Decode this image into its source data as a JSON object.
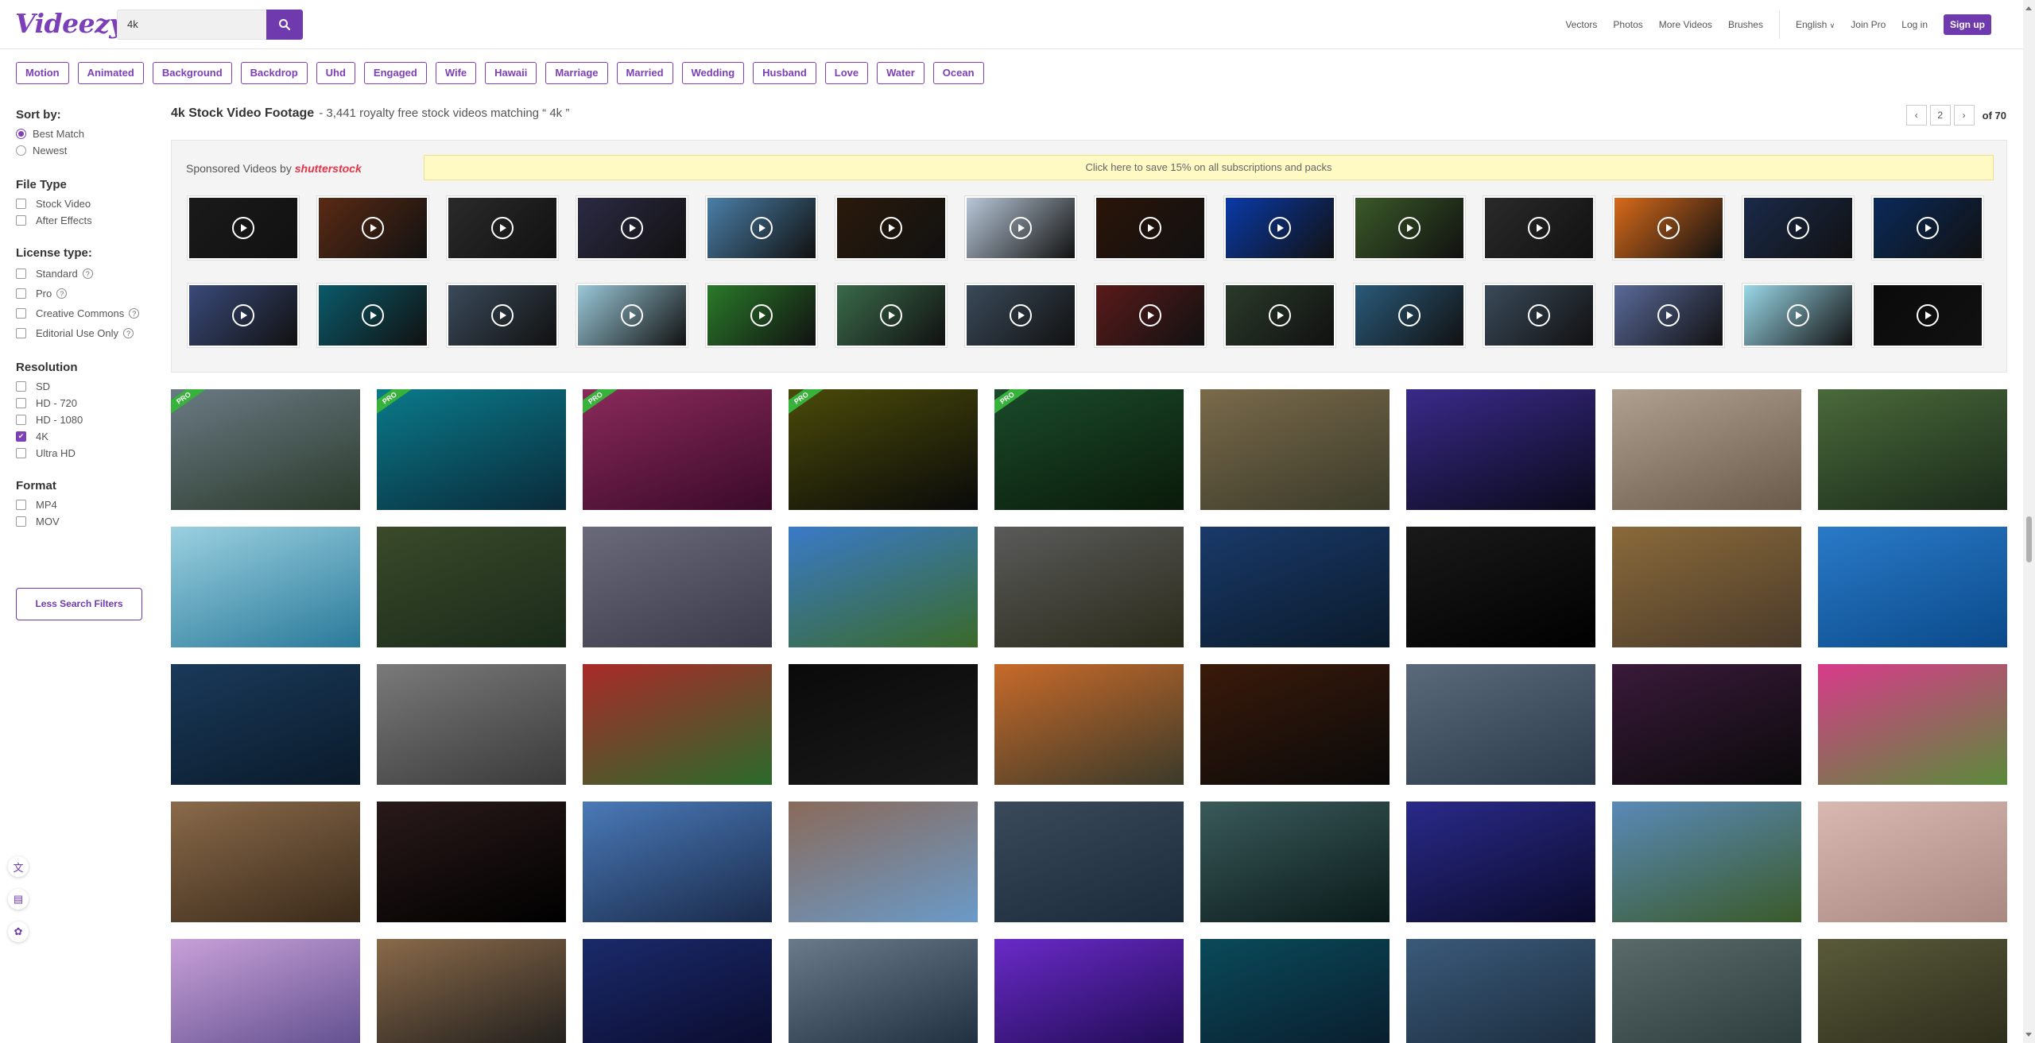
{
  "header": {
    "logo": "Videezy",
    "search_value": "4k",
    "nav": [
      "Vectors",
      "Photos",
      "More Videos",
      "Brushes"
    ],
    "language": "English",
    "join_pro": "Join Pro",
    "log_in": "Log in",
    "sign_up": "Sign up"
  },
  "tags": [
    "Motion",
    "Animated",
    "Background",
    "Backdrop",
    "Uhd",
    "Engaged",
    "Wife",
    "Hawaii",
    "Marriage",
    "Married",
    "Wedding",
    "Husband",
    "Love",
    "Water",
    "Ocean"
  ],
  "sidebar": {
    "sort_title": "Sort by:",
    "sort_options": [
      "Best Match",
      "Newest"
    ],
    "file_type_title": "File Type",
    "file_types": [
      "Stock Video",
      "After Effects"
    ],
    "license_title": "License type:",
    "licenses": [
      "Standard",
      "Pro",
      "Creative Commons",
      "Editorial Use Only"
    ],
    "resolution_title": "Resolution",
    "resolutions": [
      "SD",
      "HD - 720",
      "HD - 1080",
      "4K",
      "Ultra HD"
    ],
    "format_title": "Format",
    "formats": [
      "MP4",
      "MOV"
    ],
    "less_filters": "Less Search Filters"
  },
  "results": {
    "title": "4k Stock Video Footage",
    "subtitle": "- 3,441 royalty free stock videos matching “ 4k ”",
    "page": "2",
    "of_pages": "of 70"
  },
  "sponsored": {
    "label": "Sponsored Videos by",
    "brand": "shutterstock",
    "promo": "Click here to save 15% on all subscriptions and packs",
    "thumbs": [
      "#1a1a1a",
      "#5a2a14",
      "#2a2a2a",
      "#2c2a44",
      "#4a7fa8",
      "#2a1a0a",
      "#b8c8d8",
      "#2a1408",
      "#0a3aa8",
      "#3a5a28",
      "#2a2a2a",
      "#d86a1a",
      "#1a2a4a",
      "#0a2a5a",
      "#3a4a7a",
      "#0a5a6a",
      "#3a4a5a",
      "#9ac8d8",
      "#2a7a2a",
      "#3a6a4a",
      "#3a4a5a",
      "#5a1a1a",
      "#2a3a2a",
      "#2a5a7a",
      "#3a4a5a",
      "#5a6a9a",
      "#9ad8e8",
      "#0a0a0a"
    ]
  },
  "grid": {
    "thumbs": [
      {
        "c1": "#6a7a84",
        "c2": "#2a3a2a",
        "pro": true
      },
      {
        "c1": "#0a7a8a",
        "c2": "#0a2a3a",
        "pro": true
      },
      {
        "c1": "#8a2a5a",
        "c2": "#3a0a2a",
        "pro": true
      },
      {
        "c1": "#4a4a0a",
        "c2": "#0a0a0a",
        "pro": true
      },
      {
        "c1": "#1a4a2a",
        "c2": "#0a1a0a",
        "pro": true
      },
      {
        "c1": "#7a6a4a",
        "c2": "#3a3a2a",
        "pro": false
      },
      {
        "c1": "#3a2a8a",
        "c2": "#0a0a1a",
        "pro": false
      },
      {
        "c1": "#b0a090",
        "c2": "#6a5a4a",
        "pro": false
      },
      {
        "c1": "#4a6a3a",
        "c2": "#1a2a1a",
        "pro": false
      },
      {
        "c1": "#9ad0e0",
        "c2": "#2a7a9a",
        "pro": false
      },
      {
        "c1": "#3a4a2a",
        "c2": "#1a2a1a",
        "pro": false
      },
      {
        "c1": "#6a6a7a",
        "c2": "#3a3a4a",
        "pro": false
      },
      {
        "c1": "#3a7ac8",
        "c2": "#3a6a2a",
        "pro": false
      },
      {
        "c1": "#5a5a5a",
        "c2": "#2a2a1a",
        "pro": false
      },
      {
        "c1": "#1a3a6a",
        "c2": "#0a1a2a",
        "pro": false
      },
      {
        "c1": "#1a1a1a",
        "c2": "#000000",
        "pro": false
      },
      {
        "c1": "#8a6a3a",
        "c2": "#4a3a2a",
        "pro": false
      },
      {
        "c1": "#2a7ac8",
        "c2": "#0a4a8a",
        "pro": false
      },
      {
        "c1": "#1a3a5a",
        "c2": "#0a1a2a",
        "pro": false
      },
      {
        "c1": "#7a7a7a",
        "c2": "#3a3a3a",
        "pro": false
      },
      {
        "c1": "#aa2a2a",
        "c2": "#2a6a2a",
        "pro": false
      },
      {
        "c1": "#0a0a0a",
        "c2": "#1a1a1a",
        "pro": false
      },
      {
        "c1": "#c86a2a",
        "c2": "#3a3a2a",
        "pro": false
      },
      {
        "c1": "#3a1a0a",
        "c2": "#0a0a0a",
        "pro": false
      },
      {
        "c1": "#5a6a7a",
        "c2": "#2a3a4a",
        "pro": false
      },
      {
        "c1": "#3a1a3a",
        "c2": "#0a0a0a",
        "pro": false
      },
      {
        "c1": "#d83a8a",
        "c2": "#5a8a3a",
        "pro": false
      },
      {
        "c1": "#8a6a4a",
        "c2": "#3a2a1a",
        "pro": false
      },
      {
        "c1": "#2a1a1a",
        "c2": "#000000",
        "pro": false
      },
      {
        "c1": "#4a7ab8",
        "c2": "#1a2a4a",
        "pro": false
      },
      {
        "c1": "#8a6a5a",
        "c2": "#6a9ac8",
        "pro": false
      },
      {
        "c1": "#3a4a5a",
        "c2": "#1a2a3a",
        "pro": false
      },
      {
        "c1": "#3a5a5a",
        "c2": "#0a1a1a",
        "pro": false
      },
      {
        "c1": "#2a2a8a",
        "c2": "#0a0a2a",
        "pro": false
      },
      {
        "c1": "#5a8ab8",
        "c2": "#3a5a2a",
        "pro": false
      },
      {
        "c1": "#d8b8b0",
        "c2": "#a88880",
        "pro": false
      },
      {
        "c1": "#c8a0d8",
        "c2": "#5a4a8a",
        "pro": false
      },
      {
        "c1": "#8a6a4a",
        "c2": "#1a1a1a",
        "pro": false
      },
      {
        "c1": "#1a2a6a",
        "c2": "#0a0a2a",
        "pro": false
      },
      {
        "c1": "#6a7a8a",
        "c2": "#1a2a3a",
        "pro": false
      },
      {
        "c1": "#6a2ac8",
        "c2": "#1a0a4a",
        "pro": false
      },
      {
        "c1": "#0a4a5a",
        "c2": "#0a1a2a",
        "pro": false
      },
      {
        "c1": "#3a5a7a",
        "c2": "#1a2a3a",
        "pro": false
      },
      {
        "c1": "#5a6a6a",
        "c2": "#2a3a3a",
        "pro": false
      },
      {
        "c1": "#5a5a3a",
        "c2": "#2a2a1a",
        "pro": false
      }
    ]
  }
}
